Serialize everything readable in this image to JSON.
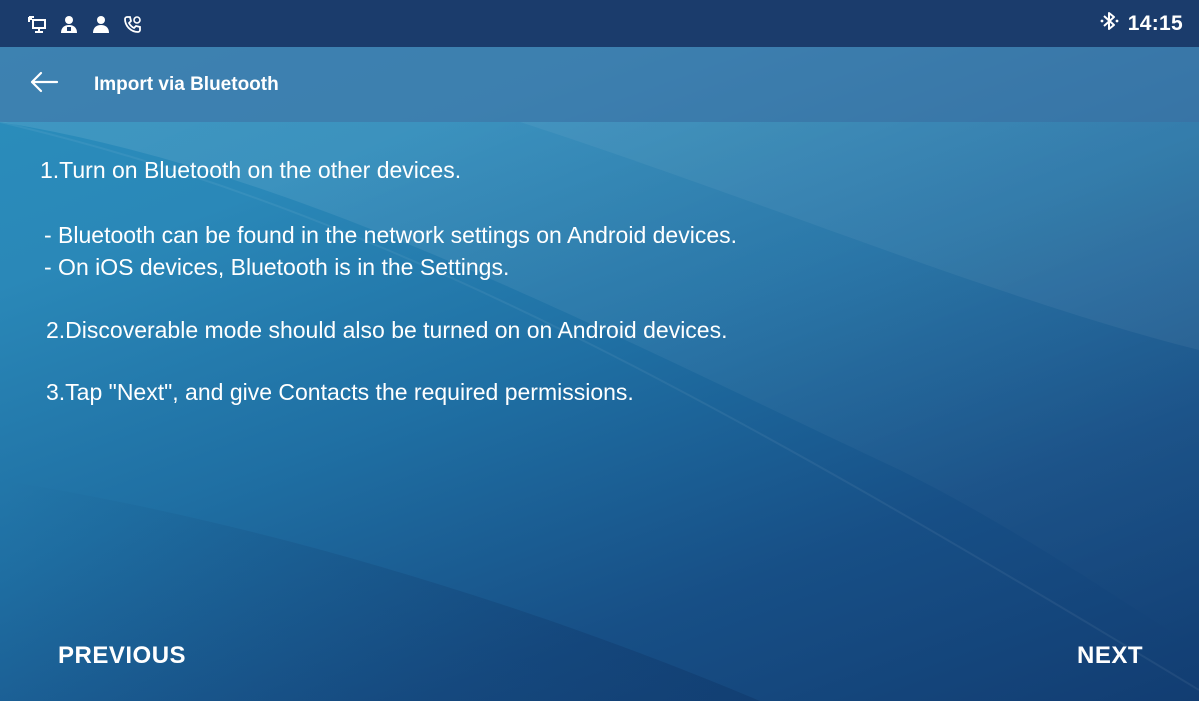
{
  "status_bar": {
    "icons_left": [
      "network-icon",
      "contact-icon",
      "contact-icon",
      "call-forward-icon"
    ],
    "bluetooth_icon": "bluetooth-icon",
    "time": "14:15"
  },
  "app_bar": {
    "back_icon": "arrow-left-icon",
    "title": "Import via Bluetooth"
  },
  "instructions": {
    "step1": "1.Turn on Bluetooth on the other devices.",
    "note1": "- Bluetooth can be found in the network settings on Android devices.",
    "note2": "- On iOS devices, Bluetooth is in the Settings.",
    "step2": "2.Discoverable mode should also be turned on on Android devices.",
    "step3": "3.Tap \"Next\", and give Contacts the required permissions."
  },
  "footer": {
    "previous_label": "PREVIOUS",
    "next_label": "NEXT"
  },
  "colors": {
    "status_bar": "#1b3c6c",
    "app_bar": "#4c78a8",
    "background_top": "#2a8fbd",
    "background_bottom": "#123d72",
    "text": "#ffffff"
  }
}
